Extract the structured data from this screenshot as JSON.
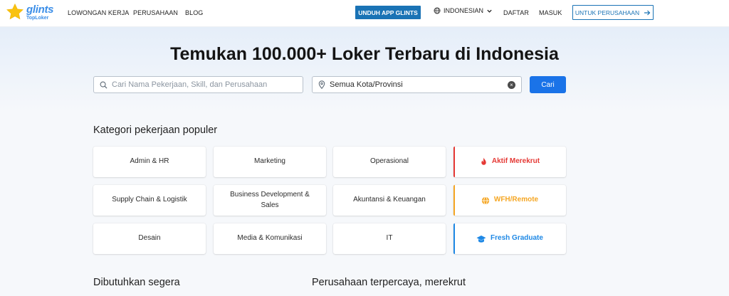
{
  "header": {
    "logo_main": "glints",
    "logo_sub": "TopLoker",
    "nav": [
      "LOWONGAN KERJA",
      "PERUSAHAAN",
      "BLOG"
    ],
    "app_button": "UNDUH APP GLINTS",
    "language": "INDONESIAN",
    "register": "DAFTAR",
    "login": "MASUK",
    "company_button": "UNTUK PERUSAHAAN"
  },
  "hero": {
    "title": "Temukan 100.000+ Loker Terbaru di Indonesia",
    "search_placeholder": "Cari Nama Pekerjaan, Skill, dan Perusahaan",
    "location_value": "Semua Kota/Provinsi",
    "search_button": "Cari"
  },
  "categories": {
    "title": "Kategori pekerjaan populer",
    "items": [
      "Admin & HR",
      "Marketing",
      "Operasional",
      "Aktif Merekrut",
      "Supply Chain & Logistik",
      "Business Development & Sales",
      "Akuntansi & Keuangan",
      "WFH/Remote",
      "Desain",
      "Media & Komunikasi",
      "IT",
      "Fresh Graduate"
    ],
    "special_colors": {
      "active": "#e53935",
      "remote": "#f5a623",
      "fresh": "#1e88e5"
    }
  },
  "sections": {
    "urgent": "Dibutuhkan segera",
    "trusted": "Perusahaan terpercaya, merekrut"
  }
}
